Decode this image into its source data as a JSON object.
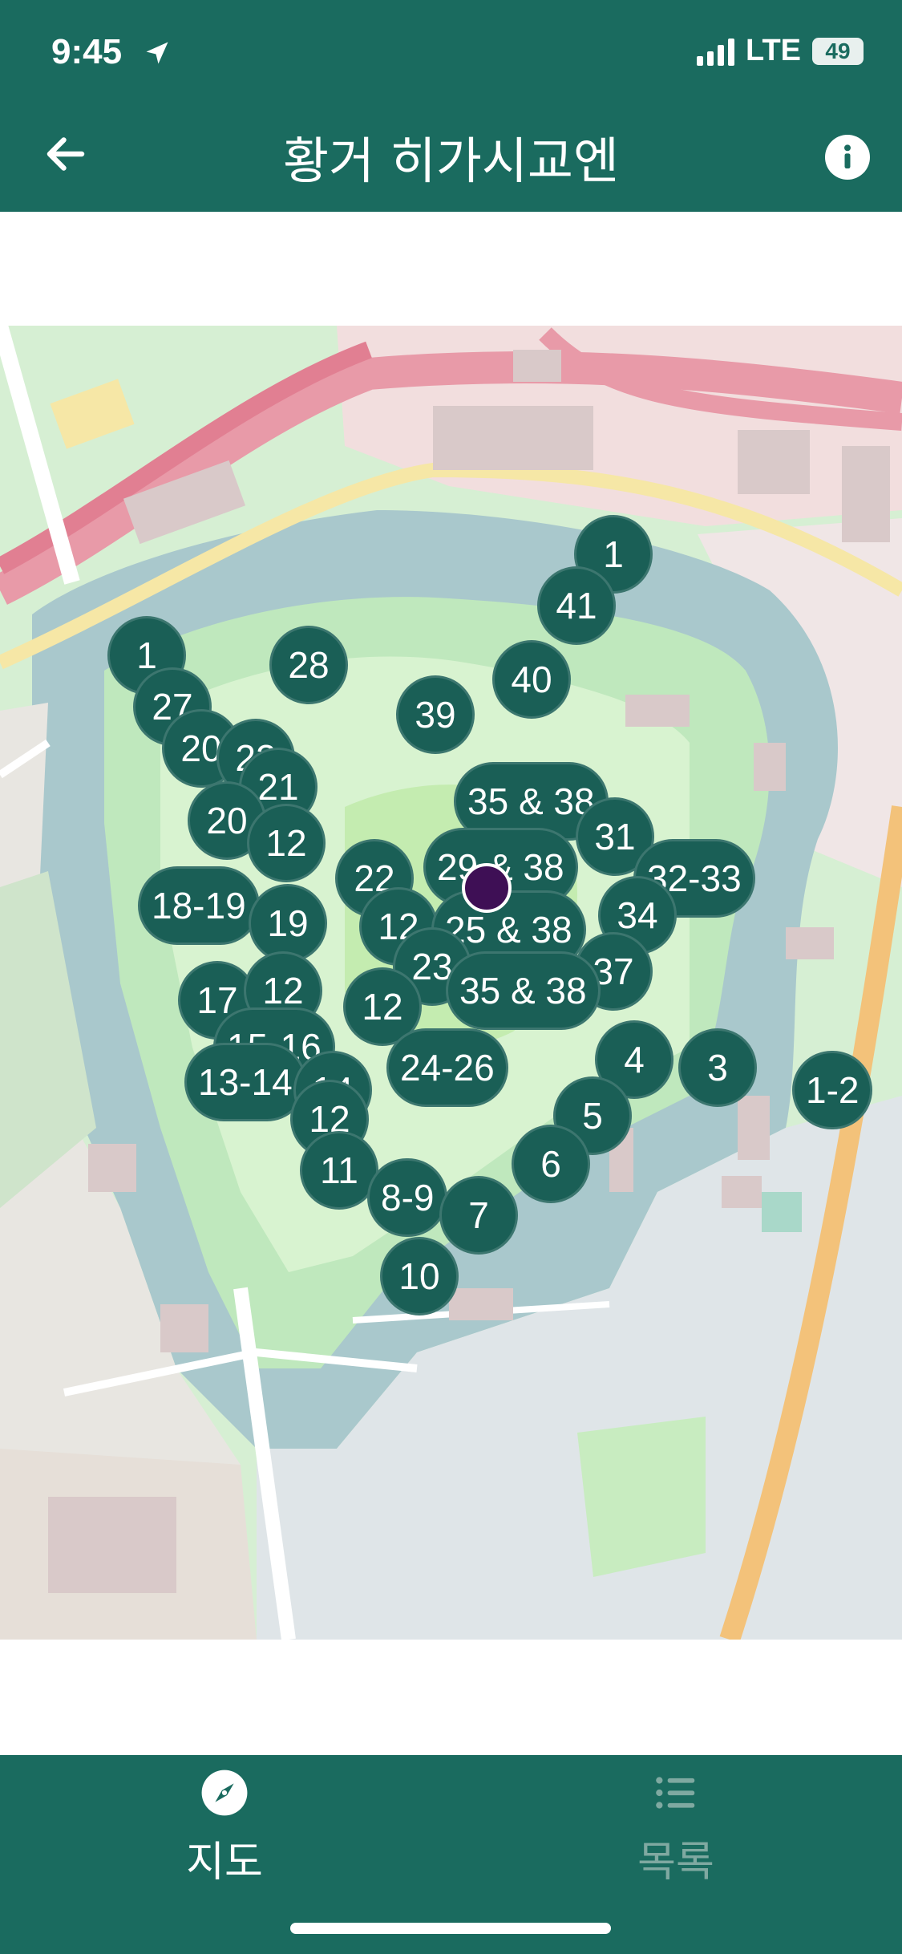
{
  "status_bar": {
    "time": "9:45",
    "network": "LTE",
    "battery": "49"
  },
  "header": {
    "title": "황거 히가시교엔",
    "back_icon": "arrow-left-icon",
    "info_icon": "info-icon"
  },
  "map": {
    "markers": [
      "1",
      "41",
      "1",
      "28",
      "40",
      "27",
      "39",
      "20",
      "22",
      "21",
      "35 & 38",
      "20",
      "12",
      "31",
      "22",
      "29 & 38",
      "32-33",
      "18-19",
      "34",
      "19",
      "12",
      "25 & 38",
      "23",
      "37",
      "17",
      "12",
      "12",
      "35 & 38",
      "15-16",
      "4",
      "3",
      "1-2",
      "13-14",
      "24-26",
      "14",
      "12",
      "5",
      "6",
      "11",
      "8-9",
      "7",
      "10"
    ],
    "current_location_icon": "location-dot-icon"
  },
  "tabbar": {
    "tabs": [
      {
        "label": "지도",
        "icon": "compass-icon",
        "active": true
      },
      {
        "label": "목록",
        "icon": "list-icon",
        "active": false
      }
    ]
  },
  "colors": {
    "brand": "#1a6b5f",
    "marker": "#1a5f56",
    "location": "#3e0f55",
    "inactive_tab": "#7fa9a1"
  }
}
